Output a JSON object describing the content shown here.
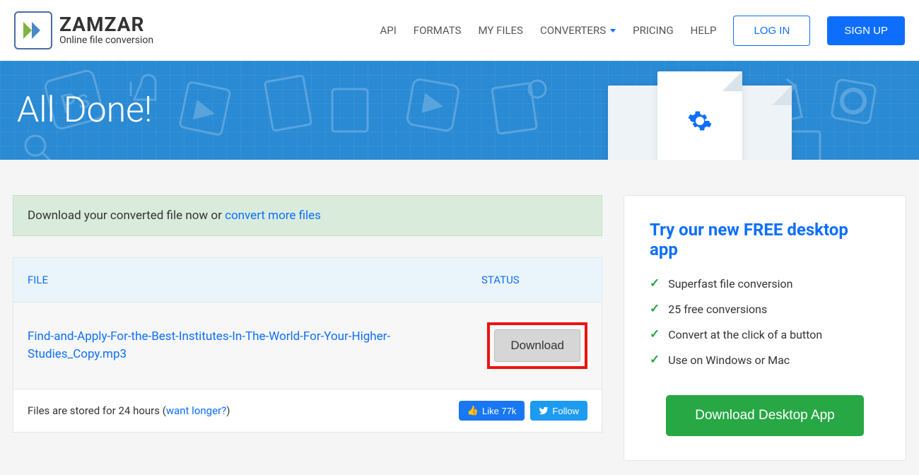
{
  "header": {
    "logo_title": "ZAMZAR",
    "logo_sub": "Online file conversion",
    "nav": {
      "api": "API",
      "formats": "FORMATS",
      "myfiles": "MY FILES",
      "converters": "CONVERTERS",
      "pricing": "PRICING",
      "help": "HELP"
    },
    "login": "LOG IN",
    "signup": "SIGN UP"
  },
  "hero": {
    "title": "All Done!"
  },
  "alert": {
    "prefix": "Download your converted file now or ",
    "link": "convert more files"
  },
  "table": {
    "head_file": "FILE",
    "head_status": "STATUS",
    "file_name": "Find-and-Apply-For-the-Best-Institutes-In-The-World-For-Your-Higher-Studies_Copy.mp3",
    "download": "Download",
    "foot_prefix": "Files are stored for 24 hours (",
    "foot_link": "want longer?",
    "foot_suffix": ")"
  },
  "social": {
    "like": "Like 77k",
    "follow": "Follow"
  },
  "sidebar": {
    "title": "Try our new FREE desktop app",
    "features": [
      "Superfast file conversion",
      "25 free conversions",
      "Convert at the click of a button",
      "Use on Windows or Mac"
    ],
    "cta": "Download Desktop App"
  }
}
